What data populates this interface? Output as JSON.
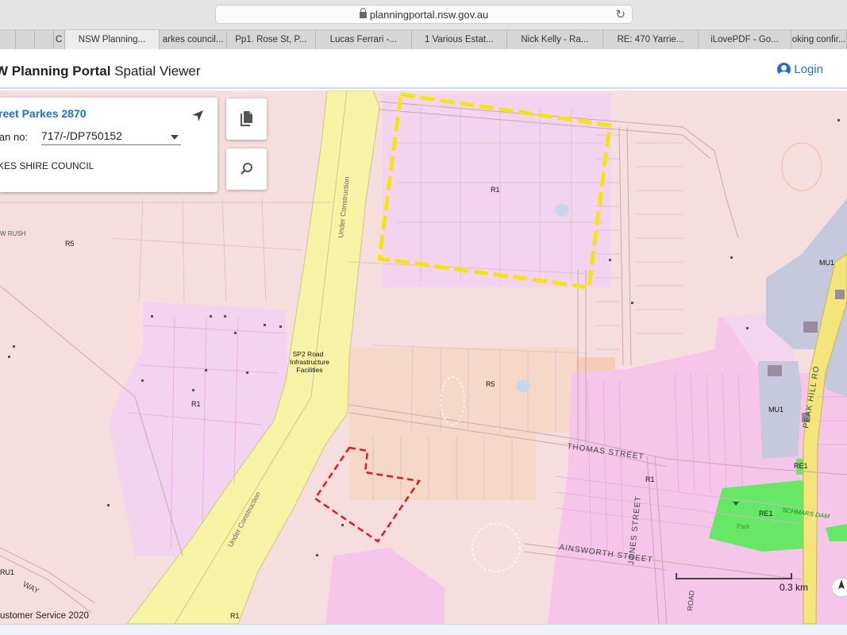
{
  "browser": {
    "url": "planningportal.nsw.gov.au",
    "tabs": [
      {
        "label": "",
        "w": 20
      },
      {
        "label": "",
        "w": 24
      },
      {
        "label": "",
        "w": 24
      },
      {
        "label": "C",
        "w": 14
      },
      {
        "label": "NSW Planning...",
        "w": 120,
        "active": true
      },
      {
        "label": "arkes council...",
        "w": 85
      },
      {
        "label": "Pp1. Rose St, P...",
        "w": 112
      },
      {
        "label": "Lucas Ferrari -...",
        "w": 122
      },
      {
        "label": "1 Various Estat...",
        "w": 120
      },
      {
        "label": "Nick Kelly - Ra...",
        "w": 122
      },
      {
        "label": "RE: 470 Yarrie...",
        "w": 120
      },
      {
        "label": "iLovePDF - Go...",
        "w": 118
      },
      {
        "label": "oking confir...",
        "w": 70
      }
    ]
  },
  "app": {
    "title_bold": "W Planning Portal",
    "title_rest": "Spatial Viewer",
    "login": "Login"
  },
  "panel": {
    "address": "reet Parkes 2870",
    "plan_label": "lan no:",
    "plan_value": "717/-/DP750152",
    "council": "KES SHIRE COUNCIL"
  },
  "map": {
    "zone_labels": [
      "R1",
      "R5",
      "R5",
      "R1",
      "R1",
      "MU1",
      "MU1",
      "RE1",
      "RE1",
      "RU1",
      "R1"
    ],
    "sp2_label": [
      "SP2 Road",
      "Infrastructure",
      "Facilities"
    ],
    "under_construction": "Under Construction",
    "streets": [
      "THOMAS   STREET",
      "JONES  STREET",
      "AINSWORTH   STREET",
      "PEAK HILL RO",
      "WAY",
      "ROAD",
      "W RUSH"
    ],
    "park_label": "SCHMARS DAM",
    "park_text": "Park",
    "scale": "0.3 km",
    "colors": {
      "r5": "#f7dede",
      "r1": "#f5c7ea",
      "r1_light": "#f4d6ef",
      "sp2": "#f7f3a5",
      "mu1": "#c6c9de",
      "re1": "#66e866",
      "peach": "#f6d8c8",
      "highlight": "#f6ef1e",
      "red_outline": "#e11a1a"
    }
  },
  "footer": "ustomer Service 2020"
}
